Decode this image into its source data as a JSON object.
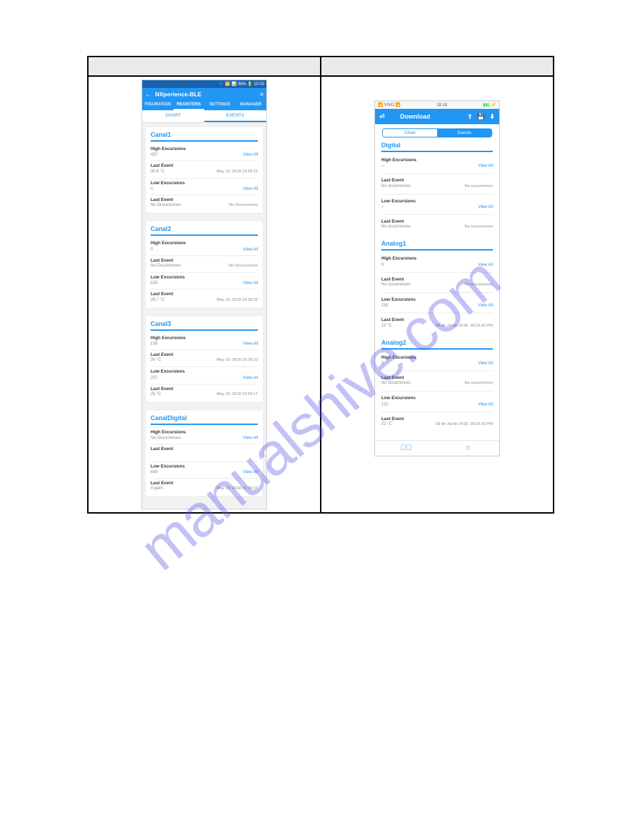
{
  "watermark": "manualshive.com",
  "android": {
    "status": "🔵 📶 📊 98% 🔋 15:00",
    "title": "NXperience-BLE",
    "navtabs": [
      "FIGURATION",
      "REGISTERS",
      "SETTINGS",
      "MANAGER"
    ],
    "navtab_active_idx": 1,
    "subtabs": {
      "chart": "CHART",
      "events": "EVENTS"
    },
    "view_all": "View All",
    "channels": [
      {
        "name": "Canal1",
        "high": {
          "label": "High Excursions",
          "value": "437"
        },
        "high_last": {
          "label": "Last Event",
          "value": "30.6 °C",
          "ts": "May 10, 2018 15:55:22"
        },
        "low": {
          "label": "Low Excursions",
          "value": "0"
        },
        "low_last": {
          "label": "Last Event",
          "value": "No Occurrences",
          "ts": "No Occurrences"
        }
      },
      {
        "name": "Canal2",
        "high": {
          "label": "High Excursions",
          "value": "0"
        },
        "high_last": {
          "label": "Last Event",
          "value": "No Occurrences",
          "ts": "No Occurrences"
        },
        "low": {
          "label": "Low Excursions",
          "value": "635"
        },
        "low_last": {
          "label": "Last Event",
          "value": "26.7 °C",
          "ts": "May 10, 2018 15:58:32"
        }
      },
      {
        "name": "Canal3",
        "high": {
          "label": "High Excursions",
          "value": "156"
        },
        "high_last": {
          "label": "Last Event",
          "value": "30 °C",
          "ts": "May 10, 2018 15:26:32"
        },
        "low": {
          "label": "Low Excursions",
          "value": "237"
        },
        "low_last": {
          "label": "Last Event",
          "value": "25 °C",
          "ts": "May 10, 2018 15:59:17"
        }
      },
      {
        "name": "CanalDigital",
        "high": {
          "label": "High Excursions",
          "value": "No Occurrences"
        },
        "high_last": {
          "label": "Last Event",
          "value": "",
          "ts": ""
        },
        "low": {
          "label": "Low Excursions",
          "value": "649"
        },
        "low_last": {
          "label": "Last Event",
          "value": "0 gal/s",
          "ts": "May 10, 2018 15:59:17"
        }
      }
    ]
  },
  "ios": {
    "status": {
      "carrier": "📶 VIVO 📶",
      "time": "18:19",
      "batt": "▮▮▯ ⚡"
    },
    "title": "Download",
    "seg": {
      "chart": "Chart",
      "events": "Events"
    },
    "view_all": "View All",
    "channels": [
      {
        "name": "Digital",
        "high": {
          "label": "High Excursions",
          "value": "--"
        },
        "high_last": {
          "label": "Last Event",
          "value": "No occurrences",
          "right": "No occurrences"
        },
        "low": {
          "label": "Low Excursions",
          "value": "--"
        },
        "low_last": {
          "label": "Last Event",
          "value": "No occurrences",
          "right": "No occurrences"
        }
      },
      {
        "name": "Analog1",
        "high": {
          "label": "High Excursions",
          "value": "0"
        },
        "high_last": {
          "label": "Last Event",
          "value": "No occurrences",
          "right": "No occurrences"
        },
        "low": {
          "label": "Low Excursions",
          "value": "116"
        },
        "low_last": {
          "label": "Last Event",
          "value": "23 °C",
          "right": "09 de Jul de 2018, 18:16:30 PM"
        }
      },
      {
        "name": "Analog2",
        "high": {
          "label": "High Excursions",
          "value": "0"
        },
        "high_last": {
          "label": "Last Event",
          "value": "No occurrences",
          "right": "No occurrences"
        },
        "low": {
          "label": "Low Excursions",
          "value": "122"
        },
        "low_last": {
          "label": "Last Event",
          "value": "21 °C",
          "right": "09 de Jul de 2018, 18:18:30 PM"
        }
      }
    ]
  }
}
